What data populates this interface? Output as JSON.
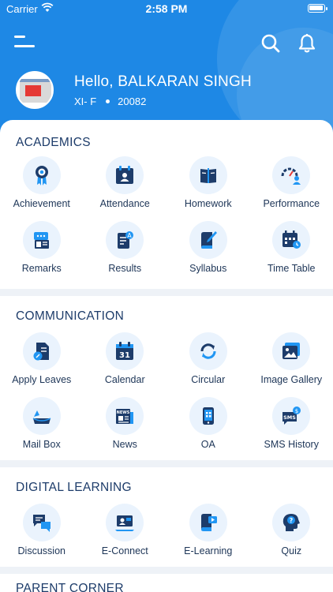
{
  "status_bar": {
    "carrier": "Carrier",
    "time": "2:58 PM"
  },
  "header": {
    "greeting": "Hello, BALKARAN SINGH",
    "class": "XI- F",
    "admission_no": "20082",
    "accent_color": "#1e88e5"
  },
  "sections": [
    {
      "title": "ACADEMICS",
      "items": [
        {
          "label": "Achievement",
          "icon": "medal-icon"
        },
        {
          "label": "Attendance",
          "icon": "calendar-person-icon"
        },
        {
          "label": "Homework",
          "icon": "book-icon"
        },
        {
          "label": "Performance",
          "icon": "gauge-icon"
        },
        {
          "label": "Remarks",
          "icon": "message-card-icon"
        },
        {
          "label": "Results",
          "icon": "result-sheet-icon"
        },
        {
          "label": "Syllabus",
          "icon": "pen-book-icon"
        },
        {
          "label": "Time Table",
          "icon": "timetable-icon"
        }
      ]
    },
    {
      "title": "COMMUNICATION",
      "items": [
        {
          "label": "Apply Leaves",
          "icon": "leave-form-icon"
        },
        {
          "label": "Calendar",
          "icon": "calendar-icon"
        },
        {
          "label": "Circular",
          "icon": "refresh-icon"
        },
        {
          "label": "Image Gallery",
          "icon": "image-icon"
        },
        {
          "label": "Mail Box",
          "icon": "mailbox-icon"
        },
        {
          "label": "News",
          "icon": "newspaper-icon"
        },
        {
          "label": "OA",
          "icon": "phone-icon"
        },
        {
          "label": "SMS History",
          "icon": "sms-icon"
        }
      ]
    },
    {
      "title": "DIGITAL LEARNING",
      "items": [
        {
          "label": "Discussion",
          "icon": "chat-icon"
        },
        {
          "label": "E-Connect",
          "icon": "video-call-icon"
        },
        {
          "label": "E-Learning",
          "icon": "play-book-icon"
        },
        {
          "label": "Quiz",
          "icon": "head-question-icon"
        }
      ]
    },
    {
      "title": "PARENT CORNER",
      "items": []
    }
  ]
}
